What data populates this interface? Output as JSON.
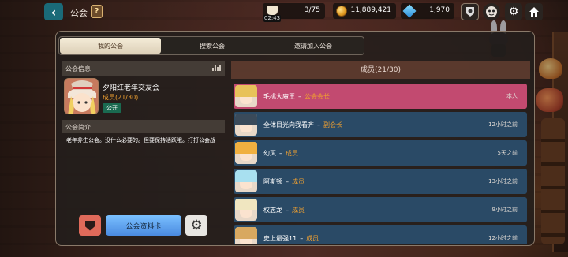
{
  "header": {
    "title": "公会",
    "help_label": "?",
    "back_label": "‹",
    "energy": {
      "value": "3/75",
      "timer": "02:43",
      "icon": "coffee-cup-icon"
    },
    "gold": {
      "value": "11,889,421",
      "icon": "coin-icon"
    },
    "gems": {
      "value": "1,970",
      "icon": "diamond-icon"
    },
    "icons": [
      "badge-icon",
      "avatar-icon",
      "gear-icon",
      "home-icon"
    ]
  },
  "tabs": [
    "我的公会",
    "搜索公会",
    "邀请加入公会"
  ],
  "guild_info": {
    "header": "公会信息",
    "name": "夕阳红老年交友会",
    "members": "成员(21/30)",
    "visibility": "公开"
  },
  "guild_intro": {
    "header": "公会简介",
    "text": "老年养生公会。没什么必要的。但要保持活跃哦。打打公会战"
  },
  "buttons": {
    "guild_card": "公会资料卡"
  },
  "member_list": {
    "header": "成员(21/30)",
    "members": [
      {
        "name": "毛桃大魔王",
        "role": "公会会长",
        "time": "本人",
        "hair": "#e8c25a"
      },
      {
        "name": "全体目光向我看齐",
        "role": "副会长",
        "time": "12小时之前",
        "hair": "#3a4a5a"
      },
      {
        "name": "幻灭",
        "role": "成员",
        "time": "5天之前",
        "hair": "#f0b040"
      },
      {
        "name": "阿斯顿",
        "role": "成员",
        "time": "13小时之前",
        "hair": "#a8e0f0"
      },
      {
        "name": "权志龙",
        "role": "成员",
        "time": "9小时之前",
        "hair": "#f0e6c0"
      },
      {
        "name": "史上最强11",
        "role": "成员",
        "time": "12小时之前",
        "hair": "#d8a860"
      }
    ]
  },
  "colors": {
    "accent_orange": "#f0a030",
    "self_row": "#c24a70",
    "row": "#2a4a66"
  }
}
